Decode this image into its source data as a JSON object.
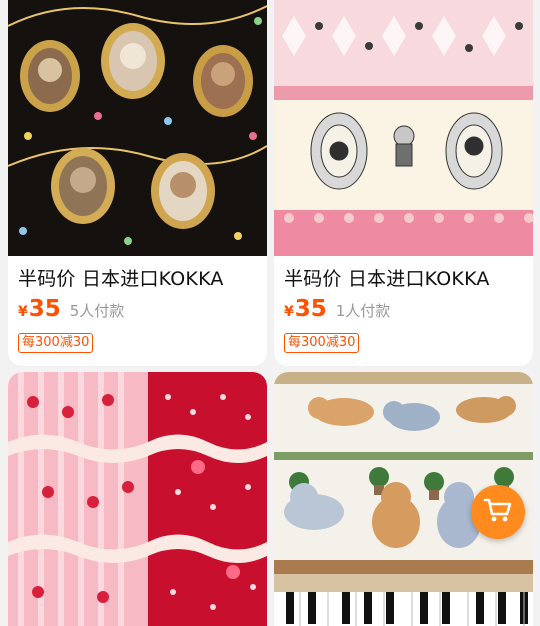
{
  "products": [
    {
      "title": "半码价 日本进口KOKKA",
      "currency": "¥",
      "price": "35",
      "sold": "5人付款",
      "coupon": "每300减30",
      "image_icon": "animal-portrait-fabric"
    },
    {
      "title": "半码价 日本进口KOKKA",
      "currency": "¥",
      "price": "35",
      "sold": "1人付款",
      "coupon": "每300减30",
      "image_icon": "alice-pink-fabric"
    },
    {
      "image_icon": "strawberry-fabric"
    },
    {
      "image_icon": "cat-fabric"
    }
  ],
  "cart_button": {
    "icon": "shopping-cart-icon",
    "color": "#ff8a1e"
  },
  "colors": {
    "price": "#ff5000",
    "muted": "#999999",
    "background": "#f2f2f2"
  }
}
